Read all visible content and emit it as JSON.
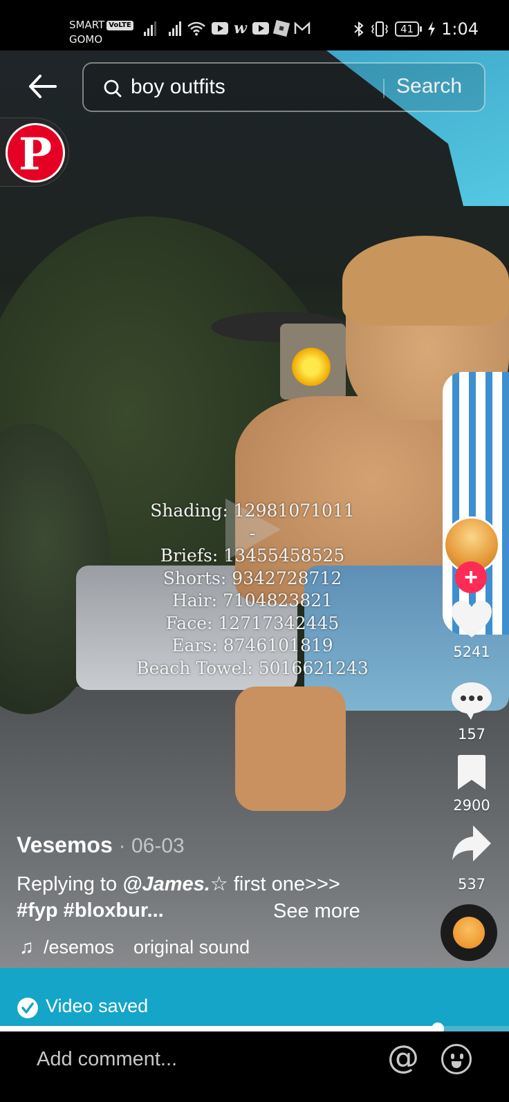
{
  "status_bar": {
    "carrier_line1": "SMART",
    "volte_badge": "VoLTE",
    "carrier_line2": "GOMO",
    "app_icons": [
      "signal-1-icon",
      "signal-2-icon",
      "wifi-icon",
      "youtube-icon",
      "w-app-icon",
      "youtube-icon",
      "roblox-icon",
      "gmail-icon"
    ],
    "bluetooth": "bluetooth-icon",
    "vibrate": "vibrate-icon",
    "battery_level": "41",
    "charging": "charging-icon",
    "time": "1:04"
  },
  "search": {
    "query": "boy outfits",
    "button_label": "Search"
  },
  "pinterest": {
    "glyph": "P"
  },
  "video": {
    "overlay_lines": [
      "Shading: 12981071011",
      "-",
      "Briefs: 13455458525",
      "Shorts: 9342728712",
      "Hair: 7104823821",
      "Face: 12717342445",
      "Ears: 8746101819",
      "Beach Towel: 5016621243"
    ]
  },
  "actions": {
    "follow_glyph": "+",
    "likes": "5241",
    "comments": "157",
    "saves": "2900",
    "shares": "537"
  },
  "post": {
    "author": "Vesemos",
    "date": "· 06-03",
    "caption_prefix": "Replying to ",
    "mention": "@James.",
    "caption_star": "☆",
    "caption_after": " first one>>> ",
    "hashtags": "#fyp #bloxbur...",
    "see_more": "See more",
    "sound_author": "/esemos",
    "sound_name": "original sound"
  },
  "toast": {
    "text": "Video saved"
  },
  "playback": {
    "progress_percent": 86
  },
  "comment_bar": {
    "placeholder": "Add comment...",
    "at_glyph": "@"
  },
  "colors": {
    "toast_bg": "#14a5c8",
    "follow_red": "#fe2c55",
    "pinterest_red": "#e60023"
  }
}
